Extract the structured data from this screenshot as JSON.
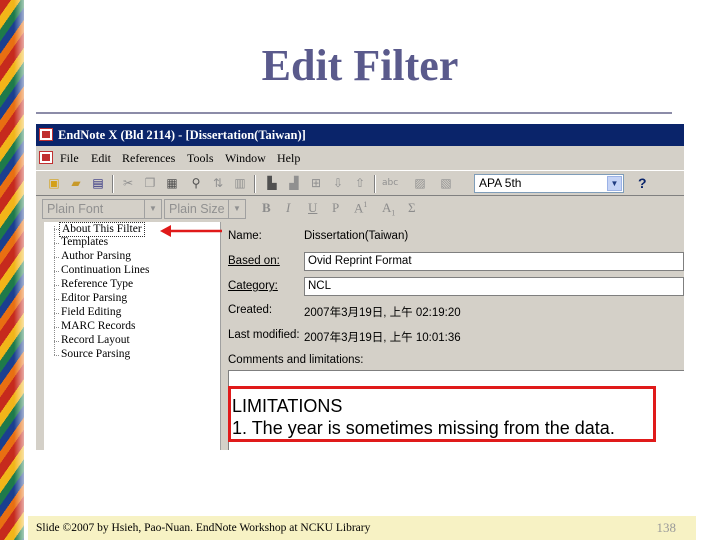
{
  "slide": {
    "title": "Edit Filter",
    "footer_text": "Slide ©2007 by Hsieh, Pao-Nuan. EndNote Workshop at NCKU Library",
    "page_number": "138"
  },
  "window": {
    "title": "EndNote X (Bld 2114) - [Dissertation(Taiwan)]"
  },
  "menu": {
    "items": [
      "File",
      "Edit",
      "References",
      "Tools",
      "Window",
      "Help"
    ]
  },
  "toolbar": {
    "style_value": "APA 5th",
    "help_symbol": "?",
    "icons": [
      "new-icon",
      "open-icon",
      "save-icon",
      "cut-icon",
      "copy-icon",
      "paste-icon",
      "find-icon",
      "sort-icon",
      "format-icon",
      "insert-icon",
      "spellcheck-icon",
      "image-icon",
      "help-icon"
    ]
  },
  "format_bar": {
    "font_value": "Plain Font",
    "size_value": "Plain Size",
    "buttons": [
      "B",
      "I",
      "U",
      "P",
      "A",
      "A",
      "Σ"
    ],
    "superscript_mark": "1",
    "subscript_mark": "1"
  },
  "tree": {
    "items": [
      "About This Filter",
      "Templates",
      "Author Parsing",
      "Continuation Lines",
      "Reference Type",
      "Editor Parsing",
      "Field Editing",
      "MARC Records",
      "Record Layout",
      "Source Parsing"
    ],
    "selected_index": 0
  },
  "details": {
    "name_label": "Name:",
    "name_value": "Dissertation(Taiwan)",
    "based_on_label": "Based on:",
    "based_on_value": "Ovid Reprint Format",
    "category_label": "Category:",
    "category_value": "NCL",
    "created_label": "Created:",
    "created_value": "2007年3月19日, 上午 02:19:20",
    "modified_label": "Last modified:",
    "modified_value": "2007年3月19日, 上午 10:01:36",
    "comments_label": "Comments and limitations:"
  },
  "annotation": {
    "line1": "LIMITATIONS",
    "line2": "1. The year is sometimes missing from the data."
  },
  "colors": {
    "title": "#5a5a8c",
    "titlebar": "#0a246a",
    "highlight_border": "#e01a1a",
    "footer_bg": "#f7f2c4"
  }
}
